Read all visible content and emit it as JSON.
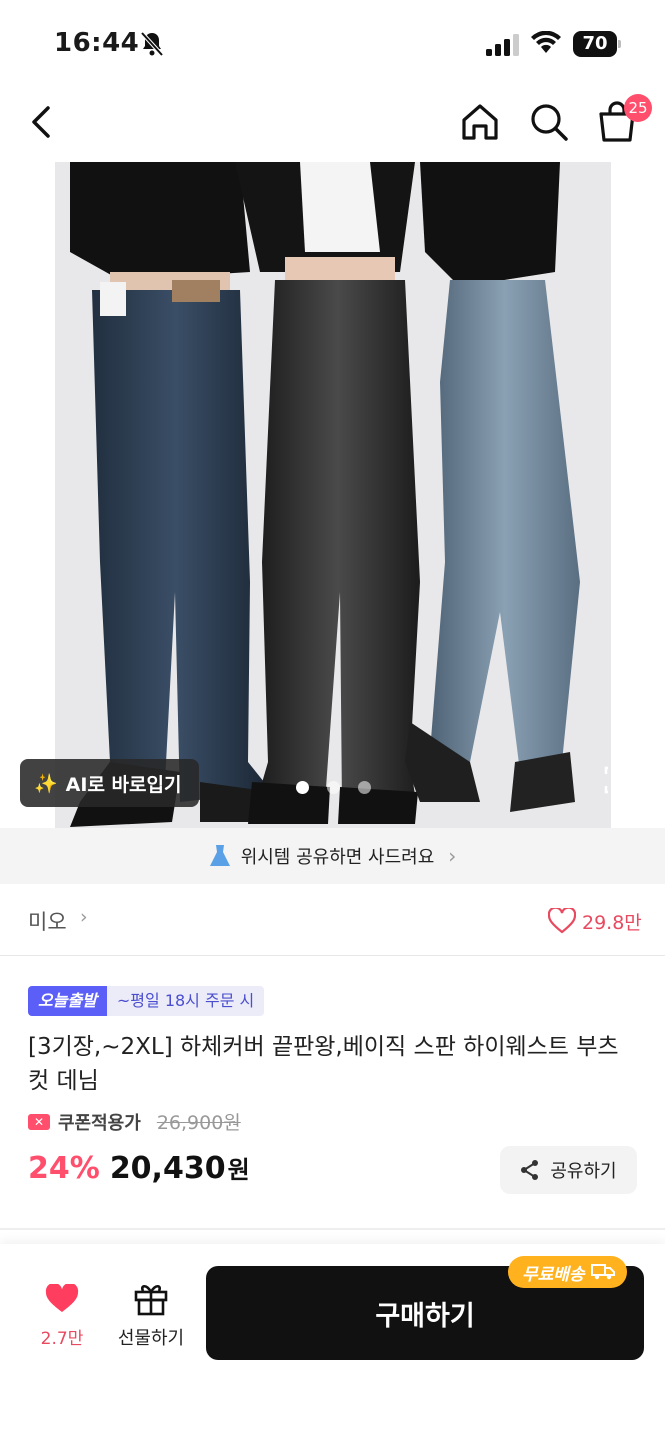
{
  "status_bar": {
    "time": "16:44",
    "battery": "70"
  },
  "nav": {
    "cart_count": "25"
  },
  "image": {
    "ai_button_label": "AI로 바로입기",
    "page_count": 3,
    "active_page": 1
  },
  "wish_banner": {
    "text": "위시템 공유하면 사드려요"
  },
  "store": {
    "name": "미오",
    "likes": "29.8만"
  },
  "product": {
    "badge_today": "오늘출발",
    "badge_cutoff": "~평일 18시 주문 시",
    "title": "[3기장,~2XL] 하체커버 끝판왕,베이직 스판 하이웨스트 부츠컷 데님",
    "coupon_label": "쿠폰적용가",
    "original_price": "26,900원",
    "discount": "24%",
    "price": "20,430",
    "currency": "원",
    "share_label": "공유하기"
  },
  "bottom_bar": {
    "like_count": "2.7만",
    "gift_label": "선물하기",
    "buy_label": "구매하기",
    "free_shipping": "무료배송"
  },
  "colors": {
    "accent_pink": "#ff4f6d",
    "badge_blue": "#5b5ff7",
    "free_ship_orange": "#ffb21e",
    "buy_black": "#111111"
  }
}
